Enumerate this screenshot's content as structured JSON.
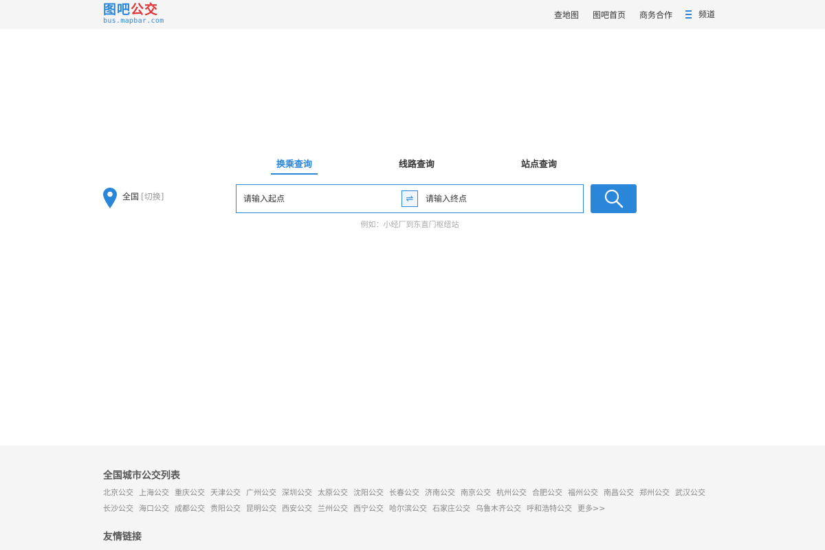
{
  "header": {
    "logo_main_a": "图吧",
    "logo_main_b": "公交",
    "logo_sub": "bus.mapbar.com",
    "nav": [
      "查地图",
      "图吧首页",
      "商务合作"
    ],
    "channel_label": "频道"
  },
  "tabs": [
    {
      "label": "换乘查询",
      "active": true
    },
    {
      "label": "线路查询",
      "active": false
    },
    {
      "label": "站点查询",
      "active": false
    }
  ],
  "city": {
    "current": "全国",
    "switch_label": "[切换]"
  },
  "search": {
    "start_placeholder": "请输入起点",
    "end_placeholder": "请输入终点",
    "swap_glyph": "⇌",
    "example": "例如：小经厂到东直门枢纽站"
  },
  "footer": {
    "city_list_title": "全国城市公交列表",
    "cities_row1": [
      "北京公交",
      "上海公交",
      "重庆公交",
      "天津公交",
      "广州公交",
      "深圳公交",
      "太原公交",
      "沈阳公交",
      "长春公交",
      "济南公交",
      "南京公交",
      "杭州公交",
      "合肥公交",
      "福州公交",
      "南昌公交",
      "郑州公交",
      "武汉公交"
    ],
    "cities_row2": [
      "长沙公交",
      "海口公交",
      "成都公交",
      "贵阳公交",
      "昆明公交",
      "西安公交",
      "兰州公交",
      "西宁公交",
      "哈尔滨公交",
      "石家庄公交",
      "乌鲁木齐公交",
      "呼和浩特公交",
      "更多>>"
    ],
    "links_title": "友情链接"
  },
  "colors": {
    "accent": "#2a86d9",
    "logo_red": "#e03338"
  },
  "icons": [
    "location-pin-icon",
    "swap-icon",
    "search-icon",
    "menu-icon"
  ]
}
